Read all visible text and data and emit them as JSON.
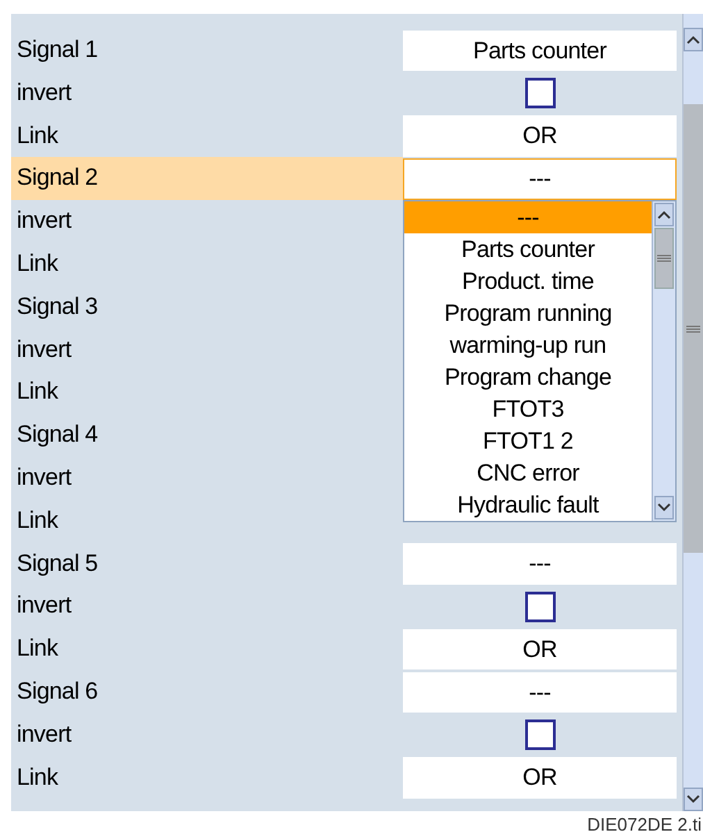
{
  "rows": [
    {
      "kind": "signal",
      "label": "Signal 1",
      "value": "Parts counter",
      "selected": false
    },
    {
      "kind": "invert",
      "label": "invert",
      "checked": false,
      "selected": false
    },
    {
      "kind": "link",
      "label": "Link",
      "value": "OR",
      "selected": false
    },
    {
      "kind": "signal",
      "label": "Signal 2",
      "value": "---",
      "selected": true,
      "dropdown": {
        "items": [
          {
            "label": "---",
            "selected": true
          },
          {
            "label": "Parts counter",
            "selected": false
          },
          {
            "label": "Product. time",
            "selected": false
          },
          {
            "label": "Program running",
            "selected": false
          },
          {
            "label": "warming-up run",
            "selected": false
          },
          {
            "label": "Program change",
            "selected": false
          },
          {
            "label": "FTOT3",
            "selected": false
          },
          {
            "label": "FTOT1 2",
            "selected": false
          },
          {
            "label": "CNC error",
            "selected": false
          },
          {
            "label": "Hydraulic fault",
            "selected": false
          }
        ]
      }
    },
    {
      "kind": "invert",
      "label": "invert",
      "selected": false
    },
    {
      "kind": "link",
      "label": "Link",
      "selected": false
    },
    {
      "kind": "signal",
      "label": "Signal 3",
      "selected": false
    },
    {
      "kind": "invert",
      "label": "invert",
      "selected": false
    },
    {
      "kind": "link",
      "label": "Link",
      "selected": false
    },
    {
      "kind": "signal",
      "label": "Signal 4",
      "selected": false
    },
    {
      "kind": "invert",
      "label": "invert",
      "selected": false
    },
    {
      "kind": "link",
      "label": "Link",
      "selected": false
    },
    {
      "kind": "signal",
      "label": "Signal 5",
      "value": "---",
      "selected": false
    },
    {
      "kind": "invert",
      "label": "invert",
      "checked": false,
      "selected": false
    },
    {
      "kind": "link",
      "label": "Link",
      "value": "OR",
      "selected": false
    },
    {
      "kind": "signal",
      "label": "Signal 6",
      "value": "---",
      "selected": false
    },
    {
      "kind": "invert",
      "label": "invert",
      "checked": false,
      "selected": false
    },
    {
      "kind": "link",
      "label": "Link",
      "value": "OR",
      "selected": false
    }
  ],
  "caption": "DIE072DE 2.ti"
}
